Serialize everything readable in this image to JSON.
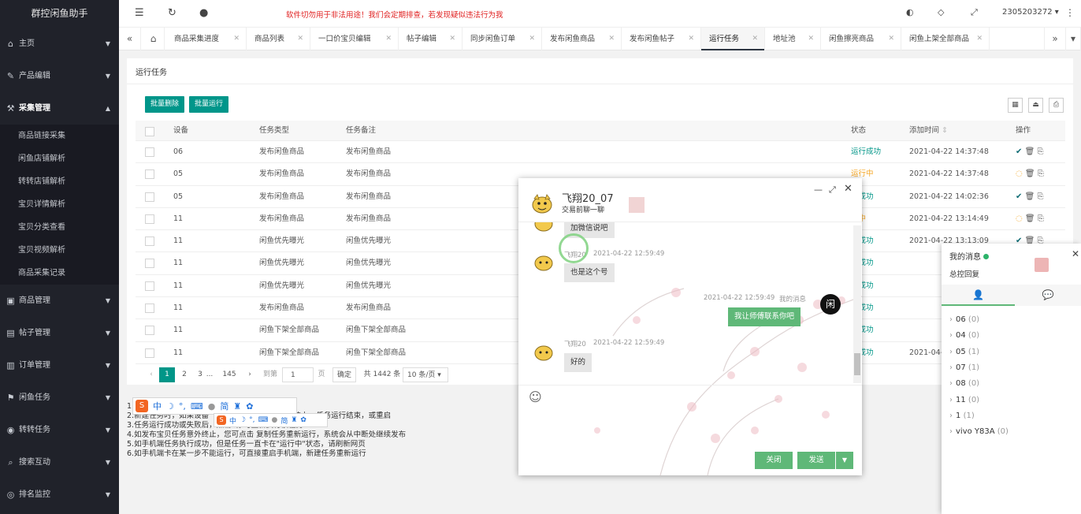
{
  "app": {
    "title": "群控闲鱼助手"
  },
  "header": {
    "notice": "软件切勿用于非法用途！我们会定期排查，若发现疑似违法行为我",
    "account": "2305203272"
  },
  "sidebar": {
    "items": [
      {
        "label": "主页",
        "icon": "home-icon"
      },
      {
        "label": "产品编辑",
        "icon": "edit-icon"
      },
      {
        "label": "采集管理",
        "icon": "collect-icon",
        "expanded": true
      },
      {
        "label": "商品管理",
        "icon": "product-icon"
      },
      {
        "label": "帖子管理",
        "icon": "post-icon"
      },
      {
        "label": "订单管理",
        "icon": "order-icon"
      },
      {
        "label": "闲鱼任务",
        "icon": "task-icon"
      },
      {
        "label": "转转任务",
        "icon": "zhuanzhuan-icon"
      },
      {
        "label": "搜索互动",
        "icon": "search-icon"
      },
      {
        "label": "排名监控",
        "icon": "rank-icon"
      }
    ],
    "sub_items": [
      "商品链接采集",
      "闲鱼店铺解析",
      "转转店铺解析",
      "宝贝详情解析",
      "宝贝分类查看",
      "宝贝视频解析",
      "商品采集记录"
    ]
  },
  "tabs": [
    "商品采集进度",
    "商品列表",
    "一口价宝贝编辑",
    "帖子编辑",
    "同步闲鱼订单",
    "发布闲鱼商品",
    "发布闲鱼帖子",
    "运行任务",
    "地址池",
    "闲鱼擦亮商品",
    "闲鱼上架全部商品"
  ],
  "active_tab": "运行任务",
  "panel": {
    "title": "运行任务",
    "batch_delete": "批量删除",
    "batch_run": "批量运行"
  },
  "table": {
    "headers": [
      "设备",
      "任务类型",
      "任务备注",
      "状态",
      "添加时间",
      "操作"
    ],
    "rows": [
      {
        "device": "06",
        "type": "发布闲鱼商品",
        "note": "发布闲鱼商品",
        "status": "运行成功",
        "time": "2021-04-22 14:37:48",
        "state": "ok"
      },
      {
        "device": "05",
        "type": "发布闲鱼商品",
        "note": "发布闲鱼商品",
        "status": "运行中",
        "time": "2021-04-22 14:37:48",
        "state": "run"
      },
      {
        "device": "05",
        "type": "发布闲鱼商品",
        "note": "发布闲鱼商品",
        "status": "行成功",
        "time": "2021-04-22 14:02:36",
        "state": "ok"
      },
      {
        "device": "11",
        "type": "发布闲鱼商品",
        "note": "发布闲鱼商品",
        "status": "行中",
        "time": "2021-04-22 13:14:49",
        "state": "run"
      },
      {
        "device": "11",
        "type": "闲鱼优先曝光",
        "note": "闲鱼优先曝光",
        "status": "行成功",
        "time": "2021-04-22 13:13:09",
        "state": "ok"
      },
      {
        "device": "11",
        "type": "闲鱼优先曝光",
        "note": "闲鱼优先曝光",
        "status": "行成功",
        "time": "",
        "state": "ok"
      },
      {
        "device": "11",
        "type": "闲鱼优先曝光",
        "note": "闲鱼优先曝光",
        "status": "行成功",
        "time": "",
        "state": "ok"
      },
      {
        "device": "11",
        "type": "发布闲鱼商品",
        "note": "发布闲鱼商品",
        "status": "行成功",
        "time": "",
        "state": "ok"
      },
      {
        "device": "11",
        "type": "闲鱼下架全部商品",
        "note": "闲鱼下架全部商品",
        "status": "行成功",
        "time": "",
        "state": "ok"
      },
      {
        "device": "11",
        "type": "闲鱼下架全部商品",
        "note": "闲鱼下架全部商品",
        "status": "行成功",
        "time": "2021-04-",
        "state": "ok"
      }
    ]
  },
  "pager": {
    "current": "1",
    "p2": "2",
    "p3": "3",
    "ellipsis": "...",
    "last": "145",
    "goto_label": "到第",
    "goto_value": "1",
    "page_unit": "页",
    "confirm": "确定",
    "total": "共 1442 条",
    "page_size": "10 条/页"
  },
  "notes": [
    "1.                                              新运行\"提示",
    "2.新建任务时，如果设备                        个任务，出现该提示请等待上一任务运行结束，或重启",
    "3.任务运行成功或失败后，点击  或  可重新执行该任务",
    "4.如发布宝贝任务意外终止，您可点击  复制任务重新运行，系统会从中断处继续发布",
    "5.如手机端任务执行成功，但是任务一直卡在\"运行中\"状态，请刷新网页",
    "6.如手机端卡在某一步不能运行，可直接重启手机端，新建任务重新运行"
  ],
  "chat": {
    "name": "飞翔20_07",
    "subtitle": "交易前聊一聊",
    "messages": [
      {
        "text": "加微信说吧"
      },
      {
        "sender": "飞翔20",
        "time": "2021-04-22 12:59:49",
        "text": "也是这个号"
      },
      {
        "sender": "我的消息",
        "time": "2021-04-22 12:59:49",
        "text": "我让师傅联系你吧",
        "avatar": "闲"
      },
      {
        "sender": "飞翔20",
        "time": "2021-04-22 12:59:49",
        "text": "好的"
      }
    ],
    "close_label": "关闭",
    "send_label": "发送"
  },
  "side_panel": {
    "title": "我的消息",
    "subtitle": "总控回复",
    "groups": [
      {
        "name": "06",
        "count": "(0)"
      },
      {
        "name": "04",
        "count": "(0)"
      },
      {
        "name": "05",
        "count": "(1)"
      },
      {
        "name": "07",
        "count": "(1)"
      },
      {
        "name": "08",
        "count": "(0)"
      },
      {
        "name": "11",
        "count": "(0)"
      },
      {
        "name": "1",
        "count": "(1)"
      },
      {
        "name": "vivo Y83A",
        "count": "(0)"
      }
    ]
  },
  "ime": {
    "lang": "中",
    "simplified": "简"
  },
  "colors": {
    "accent": "#009688",
    "success": "#009688",
    "running": "#f5a623",
    "chat_green": "#5fb878",
    "sidebar": "#20222a"
  }
}
